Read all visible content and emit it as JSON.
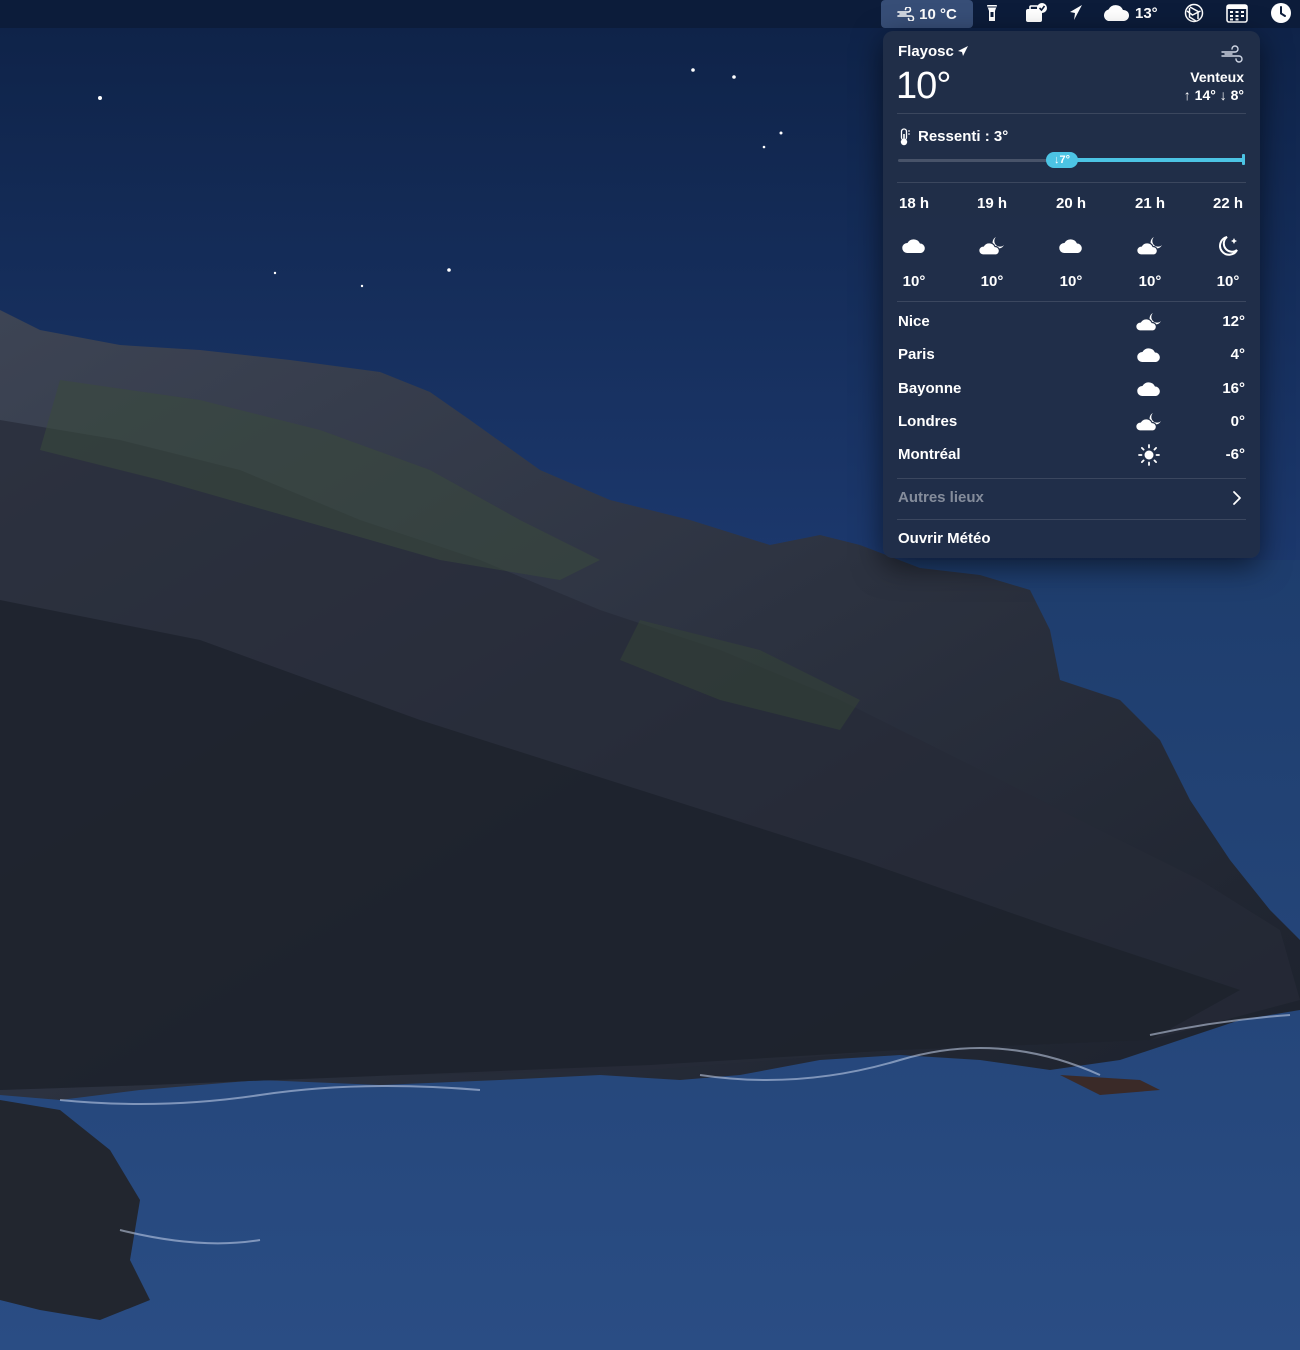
{
  "menubar": {
    "weather_temp": "10 °C",
    "cloud_temp": "13°",
    "icons": [
      "wind-icon",
      "flashlight-icon",
      "app-badge-icon",
      "arrow-icon",
      "cloud-icon",
      "openai-icon",
      "calendar-icon",
      "clock-icon"
    ]
  },
  "popover": {
    "location": "Flayosc",
    "current_temp": "10°",
    "condition": "Venteux",
    "hilo": "↑ 14° ↓ 8°",
    "feels_like": "Ressenti : 3°",
    "slider_label": "↓7°",
    "slider_value_fraction": 0.47,
    "hours": [
      {
        "label": "18 h",
        "icon": "cloud-icon",
        "temp": "10°"
      },
      {
        "label": "19 h",
        "icon": "cloud-moon-icon",
        "temp": "10°"
      },
      {
        "label": "20 h",
        "icon": "cloud-icon",
        "temp": "10°"
      },
      {
        "label": "21 h",
        "icon": "cloud-moon-icon",
        "temp": "10°"
      },
      {
        "label": "22 h",
        "icon": "moon-star-icon",
        "temp": "10°"
      }
    ],
    "cities": [
      {
        "name": "Nice",
        "icon": "cloud-moon-icon",
        "temp": "12°"
      },
      {
        "name": "Paris",
        "icon": "cloud-icon",
        "temp": "4°"
      },
      {
        "name": "Bayonne",
        "icon": "cloud-icon",
        "temp": "16°"
      },
      {
        "name": "Londres",
        "icon": "cloud-moon-icon",
        "temp": "0°"
      },
      {
        "name": "Montréal",
        "icon": "sun-icon",
        "temp": "-6°"
      }
    ],
    "other_places": "Autres lieux",
    "open_weather": "Ouvrir Météo"
  },
  "colors": {
    "accent": "#4cc4e4",
    "popover_bg": "#212e48",
    "sky_top": "#0f2347",
    "sea": "#1f3f70"
  }
}
